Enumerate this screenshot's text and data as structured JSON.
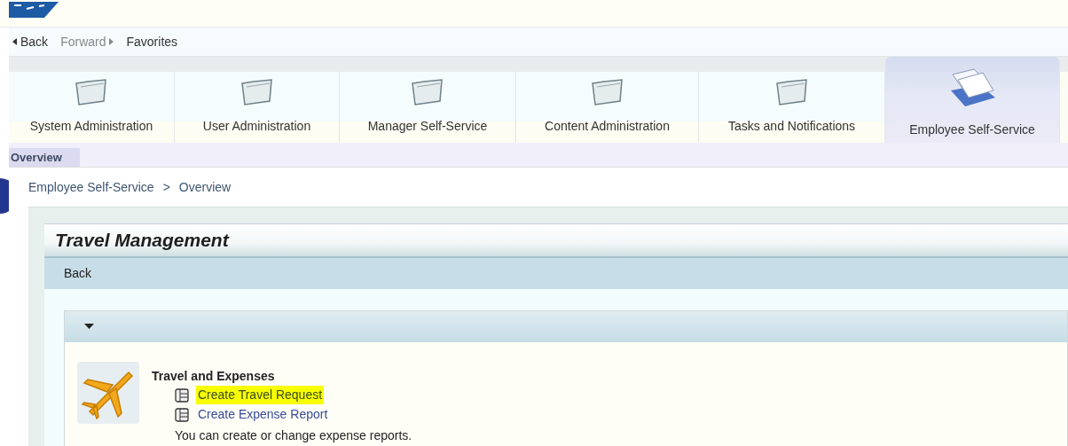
{
  "history_bar": {
    "back": "Back",
    "forward": "Forward",
    "favorites": "Favorites",
    "forward_disabled": true
  },
  "tabs": [
    {
      "label": "System Administration",
      "selected": false
    },
    {
      "label": "User Administration",
      "selected": false
    },
    {
      "label": "Manager Self-Service",
      "selected": false
    },
    {
      "label": "Content Administration",
      "selected": false
    },
    {
      "label": "Tasks and Notifications",
      "selected": false
    },
    {
      "label": "Employee Self-Service",
      "selected": true
    }
  ],
  "sub_tabs": [
    {
      "label": "Overview",
      "selected": true
    }
  ],
  "breadcrumb": [
    "Employee Self-Service",
    "Overview"
  ],
  "breadcrumb_separator": ">",
  "panel": {
    "title": "Travel Management",
    "back": "Back",
    "section": {
      "expanded": true,
      "title": "Travel and Expenses",
      "links": [
        {
          "label": "Create Travel Request",
          "highlighted": true
        },
        {
          "label": "Create Expense Report",
          "highlighted": false
        }
      ],
      "description": "You can create or change expense reports."
    }
  }
}
